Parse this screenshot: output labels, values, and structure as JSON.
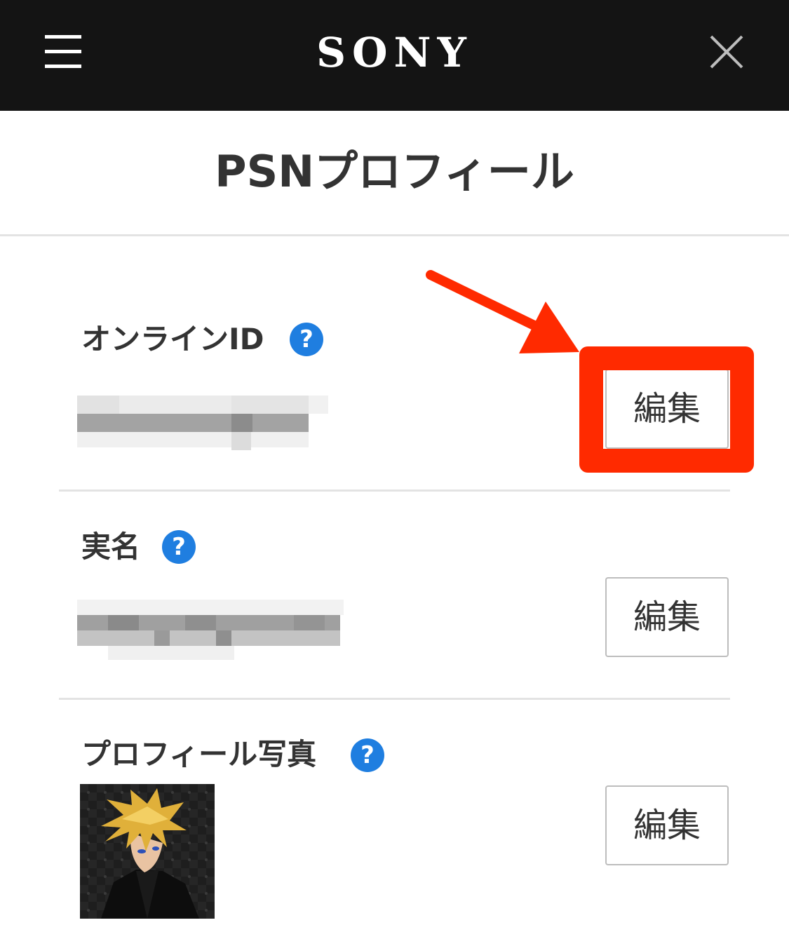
{
  "header": {
    "brand": "SONY",
    "menu_icon": "hamburger-menu-icon",
    "close_icon": "close-icon"
  },
  "page": {
    "title": "PSNプロフィール"
  },
  "sections": [
    {
      "label": "オンラインID",
      "help": "?",
      "edit_label": "編集"
    },
    {
      "label": "実名",
      "help": "?",
      "edit_label": "編集"
    },
    {
      "label": "プロフィール写真",
      "help": "?",
      "edit_label": "編集"
    }
  ],
  "colors": {
    "header_bg": "#141414",
    "help_icon": "#1f7ee0",
    "annotation": "#ff2a00"
  }
}
